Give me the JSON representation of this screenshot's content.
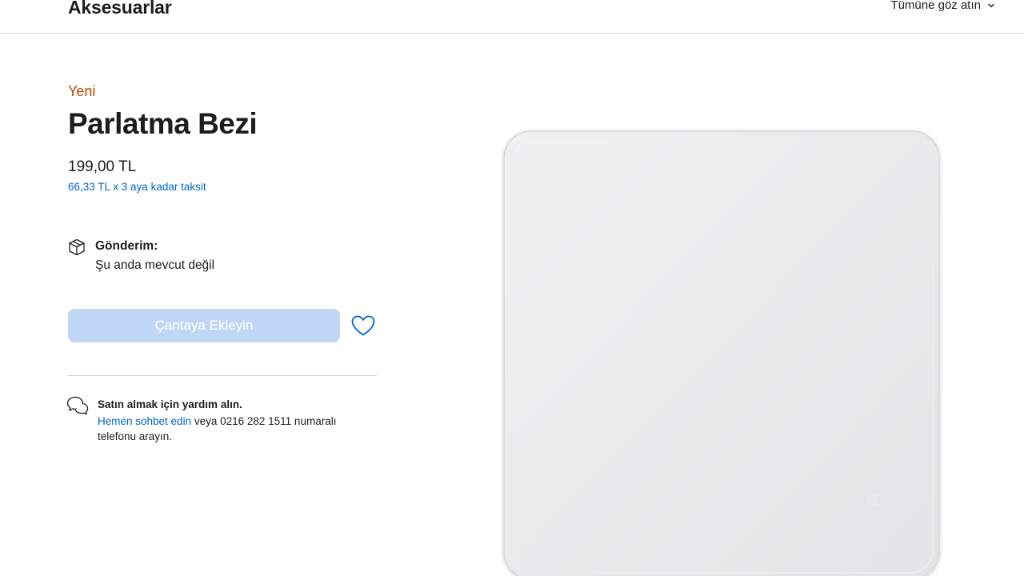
{
  "header": {
    "title": "Aksesuarlar",
    "view_all_label": "Tümüne göz atın",
    "chevron_icon": "chevron-down-icon"
  },
  "product": {
    "badge": "Yeni",
    "title": "Parlatma Bezi",
    "price": "199,00 TL",
    "installment": "66,33 TL x 3 aya kadar taksit"
  },
  "shipping": {
    "icon": "box-icon",
    "label": "Gönderim:",
    "status": "Şu anda mevcut değil"
  },
  "actions": {
    "add_to_bag_label": "Çantaya Ekleyin",
    "add_to_bag_disabled": true,
    "favorite_icon": "heart-icon"
  },
  "help": {
    "icon": "chat-bubbles-icon",
    "title": "Satın almak için yardım alın.",
    "chat_link": "Hemen sohbet edin",
    "text_rest": " veya 0216 282 1511 numaralı telefonu arayın."
  },
  "image": {
    "alt_icon": "apple-logo-icon"
  },
  "colors": {
    "badge": "#bf4800",
    "link": "#0066cc",
    "button_disabled": "#bfd7f5",
    "text": "#1d1d1f"
  }
}
